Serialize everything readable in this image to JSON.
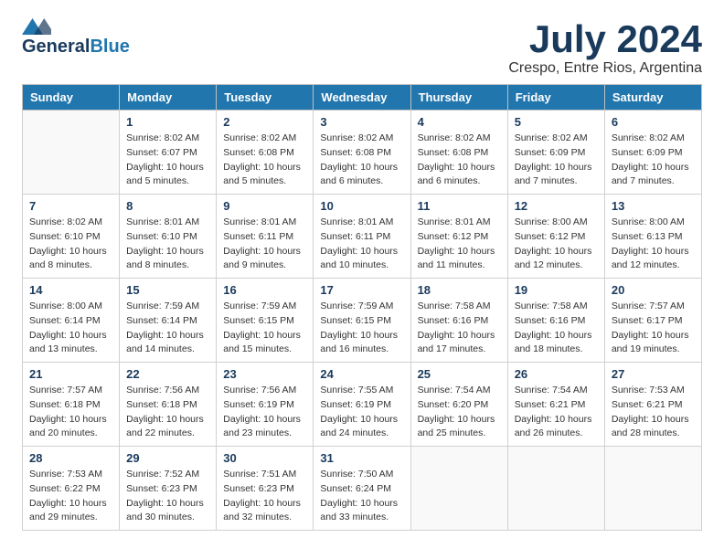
{
  "logo": {
    "general": "General",
    "blue": "Blue"
  },
  "title": {
    "month_year": "July 2024",
    "location": "Crespo, Entre Rios, Argentina"
  },
  "weekdays": [
    "Sunday",
    "Monday",
    "Tuesday",
    "Wednesday",
    "Thursday",
    "Friday",
    "Saturday"
  ],
  "weeks": [
    [
      {
        "day": null,
        "info": null
      },
      {
        "day": "1",
        "info": "Sunrise: 8:02 AM\nSunset: 6:07 PM\nDaylight: 10 hours\nand 5 minutes."
      },
      {
        "day": "2",
        "info": "Sunrise: 8:02 AM\nSunset: 6:08 PM\nDaylight: 10 hours\nand 5 minutes."
      },
      {
        "day": "3",
        "info": "Sunrise: 8:02 AM\nSunset: 6:08 PM\nDaylight: 10 hours\nand 6 minutes."
      },
      {
        "day": "4",
        "info": "Sunrise: 8:02 AM\nSunset: 6:08 PM\nDaylight: 10 hours\nand 6 minutes."
      },
      {
        "day": "5",
        "info": "Sunrise: 8:02 AM\nSunset: 6:09 PM\nDaylight: 10 hours\nand 7 minutes."
      },
      {
        "day": "6",
        "info": "Sunrise: 8:02 AM\nSunset: 6:09 PM\nDaylight: 10 hours\nand 7 minutes."
      }
    ],
    [
      {
        "day": "7",
        "info": "Sunrise: 8:02 AM\nSunset: 6:10 PM\nDaylight: 10 hours\nand 8 minutes."
      },
      {
        "day": "8",
        "info": "Sunrise: 8:01 AM\nSunset: 6:10 PM\nDaylight: 10 hours\nand 8 minutes."
      },
      {
        "day": "9",
        "info": "Sunrise: 8:01 AM\nSunset: 6:11 PM\nDaylight: 10 hours\nand 9 minutes."
      },
      {
        "day": "10",
        "info": "Sunrise: 8:01 AM\nSunset: 6:11 PM\nDaylight: 10 hours\nand 10 minutes."
      },
      {
        "day": "11",
        "info": "Sunrise: 8:01 AM\nSunset: 6:12 PM\nDaylight: 10 hours\nand 11 minutes."
      },
      {
        "day": "12",
        "info": "Sunrise: 8:00 AM\nSunset: 6:12 PM\nDaylight: 10 hours\nand 12 minutes."
      },
      {
        "day": "13",
        "info": "Sunrise: 8:00 AM\nSunset: 6:13 PM\nDaylight: 10 hours\nand 12 minutes."
      }
    ],
    [
      {
        "day": "14",
        "info": "Sunrise: 8:00 AM\nSunset: 6:14 PM\nDaylight: 10 hours\nand 13 minutes."
      },
      {
        "day": "15",
        "info": "Sunrise: 7:59 AM\nSunset: 6:14 PM\nDaylight: 10 hours\nand 14 minutes."
      },
      {
        "day": "16",
        "info": "Sunrise: 7:59 AM\nSunset: 6:15 PM\nDaylight: 10 hours\nand 15 minutes."
      },
      {
        "day": "17",
        "info": "Sunrise: 7:59 AM\nSunset: 6:15 PM\nDaylight: 10 hours\nand 16 minutes."
      },
      {
        "day": "18",
        "info": "Sunrise: 7:58 AM\nSunset: 6:16 PM\nDaylight: 10 hours\nand 17 minutes."
      },
      {
        "day": "19",
        "info": "Sunrise: 7:58 AM\nSunset: 6:16 PM\nDaylight: 10 hours\nand 18 minutes."
      },
      {
        "day": "20",
        "info": "Sunrise: 7:57 AM\nSunset: 6:17 PM\nDaylight: 10 hours\nand 19 minutes."
      }
    ],
    [
      {
        "day": "21",
        "info": "Sunrise: 7:57 AM\nSunset: 6:18 PM\nDaylight: 10 hours\nand 20 minutes."
      },
      {
        "day": "22",
        "info": "Sunrise: 7:56 AM\nSunset: 6:18 PM\nDaylight: 10 hours\nand 22 minutes."
      },
      {
        "day": "23",
        "info": "Sunrise: 7:56 AM\nSunset: 6:19 PM\nDaylight: 10 hours\nand 23 minutes."
      },
      {
        "day": "24",
        "info": "Sunrise: 7:55 AM\nSunset: 6:19 PM\nDaylight: 10 hours\nand 24 minutes."
      },
      {
        "day": "25",
        "info": "Sunrise: 7:54 AM\nSunset: 6:20 PM\nDaylight: 10 hours\nand 25 minutes."
      },
      {
        "day": "26",
        "info": "Sunrise: 7:54 AM\nSunset: 6:21 PM\nDaylight: 10 hours\nand 26 minutes."
      },
      {
        "day": "27",
        "info": "Sunrise: 7:53 AM\nSunset: 6:21 PM\nDaylight: 10 hours\nand 28 minutes."
      }
    ],
    [
      {
        "day": "28",
        "info": "Sunrise: 7:53 AM\nSunset: 6:22 PM\nDaylight: 10 hours\nand 29 minutes."
      },
      {
        "day": "29",
        "info": "Sunrise: 7:52 AM\nSunset: 6:23 PM\nDaylight: 10 hours\nand 30 minutes."
      },
      {
        "day": "30",
        "info": "Sunrise: 7:51 AM\nSunset: 6:23 PM\nDaylight: 10 hours\nand 32 minutes."
      },
      {
        "day": "31",
        "info": "Sunrise: 7:50 AM\nSunset: 6:24 PM\nDaylight: 10 hours\nand 33 minutes."
      },
      {
        "day": null,
        "info": null
      },
      {
        "day": null,
        "info": null
      },
      {
        "day": null,
        "info": null
      }
    ]
  ]
}
